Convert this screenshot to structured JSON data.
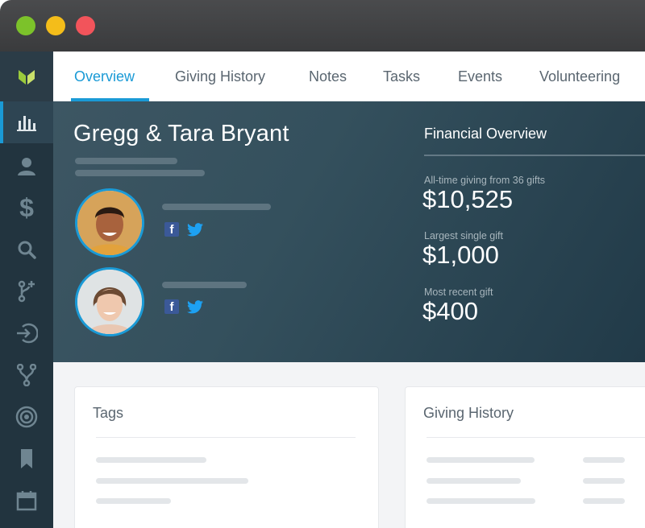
{
  "window": {
    "controls": [
      "green",
      "yellow",
      "red"
    ],
    "colors": {
      "green": "#7cc22a",
      "yellow": "#f4bd1a",
      "red": "#f2545b"
    }
  },
  "sidebar": {
    "logo": "leaf-logo",
    "items": [
      {
        "icon": "bar-chart-icon",
        "active": true
      },
      {
        "icon": "person-icon",
        "active": false
      },
      {
        "icon": "dollar-icon",
        "active": false
      },
      {
        "icon": "search-icon",
        "active": false
      },
      {
        "icon": "merge-add-icon",
        "active": false
      },
      {
        "icon": "sign-in-icon",
        "active": false
      },
      {
        "icon": "fork-icon",
        "active": false
      },
      {
        "icon": "target-icon",
        "active": false
      },
      {
        "icon": "bookmark-icon",
        "active": false
      },
      {
        "icon": "calendar-icon",
        "active": false
      }
    ]
  },
  "tabs": [
    {
      "label": "Overview",
      "active": true
    },
    {
      "label": "Giving History",
      "active": false
    },
    {
      "label": "Notes",
      "active": false
    },
    {
      "label": "Tasks",
      "active": false
    },
    {
      "label": "Events",
      "active": false
    },
    {
      "label": "Volunteering",
      "active": false
    }
  ],
  "profile": {
    "name": "Gregg & Tara Bryant",
    "people": [
      {
        "avatar": "male-avatar",
        "social": [
          "facebook-icon",
          "twitter-icon"
        ]
      },
      {
        "avatar": "female-avatar",
        "social": [
          "facebook-icon",
          "twitter-icon"
        ]
      }
    ]
  },
  "financial": {
    "title": "Financial Overview",
    "stats": [
      {
        "label": "All-time giving from 36 gifts",
        "value": "$10,525"
      },
      {
        "label": "Largest single gift",
        "value": "$1,000"
      },
      {
        "label": "Most recent gift",
        "value": "$400"
      }
    ]
  },
  "cards": {
    "tags": {
      "title": "Tags"
    },
    "giving_history": {
      "title": "Giving History"
    }
  },
  "colors": {
    "accent": "#1a9ad6",
    "sidebar": "#22343f",
    "hero": "#34505d",
    "facebook": "#3b5998",
    "twitter": "#1da1f2"
  }
}
